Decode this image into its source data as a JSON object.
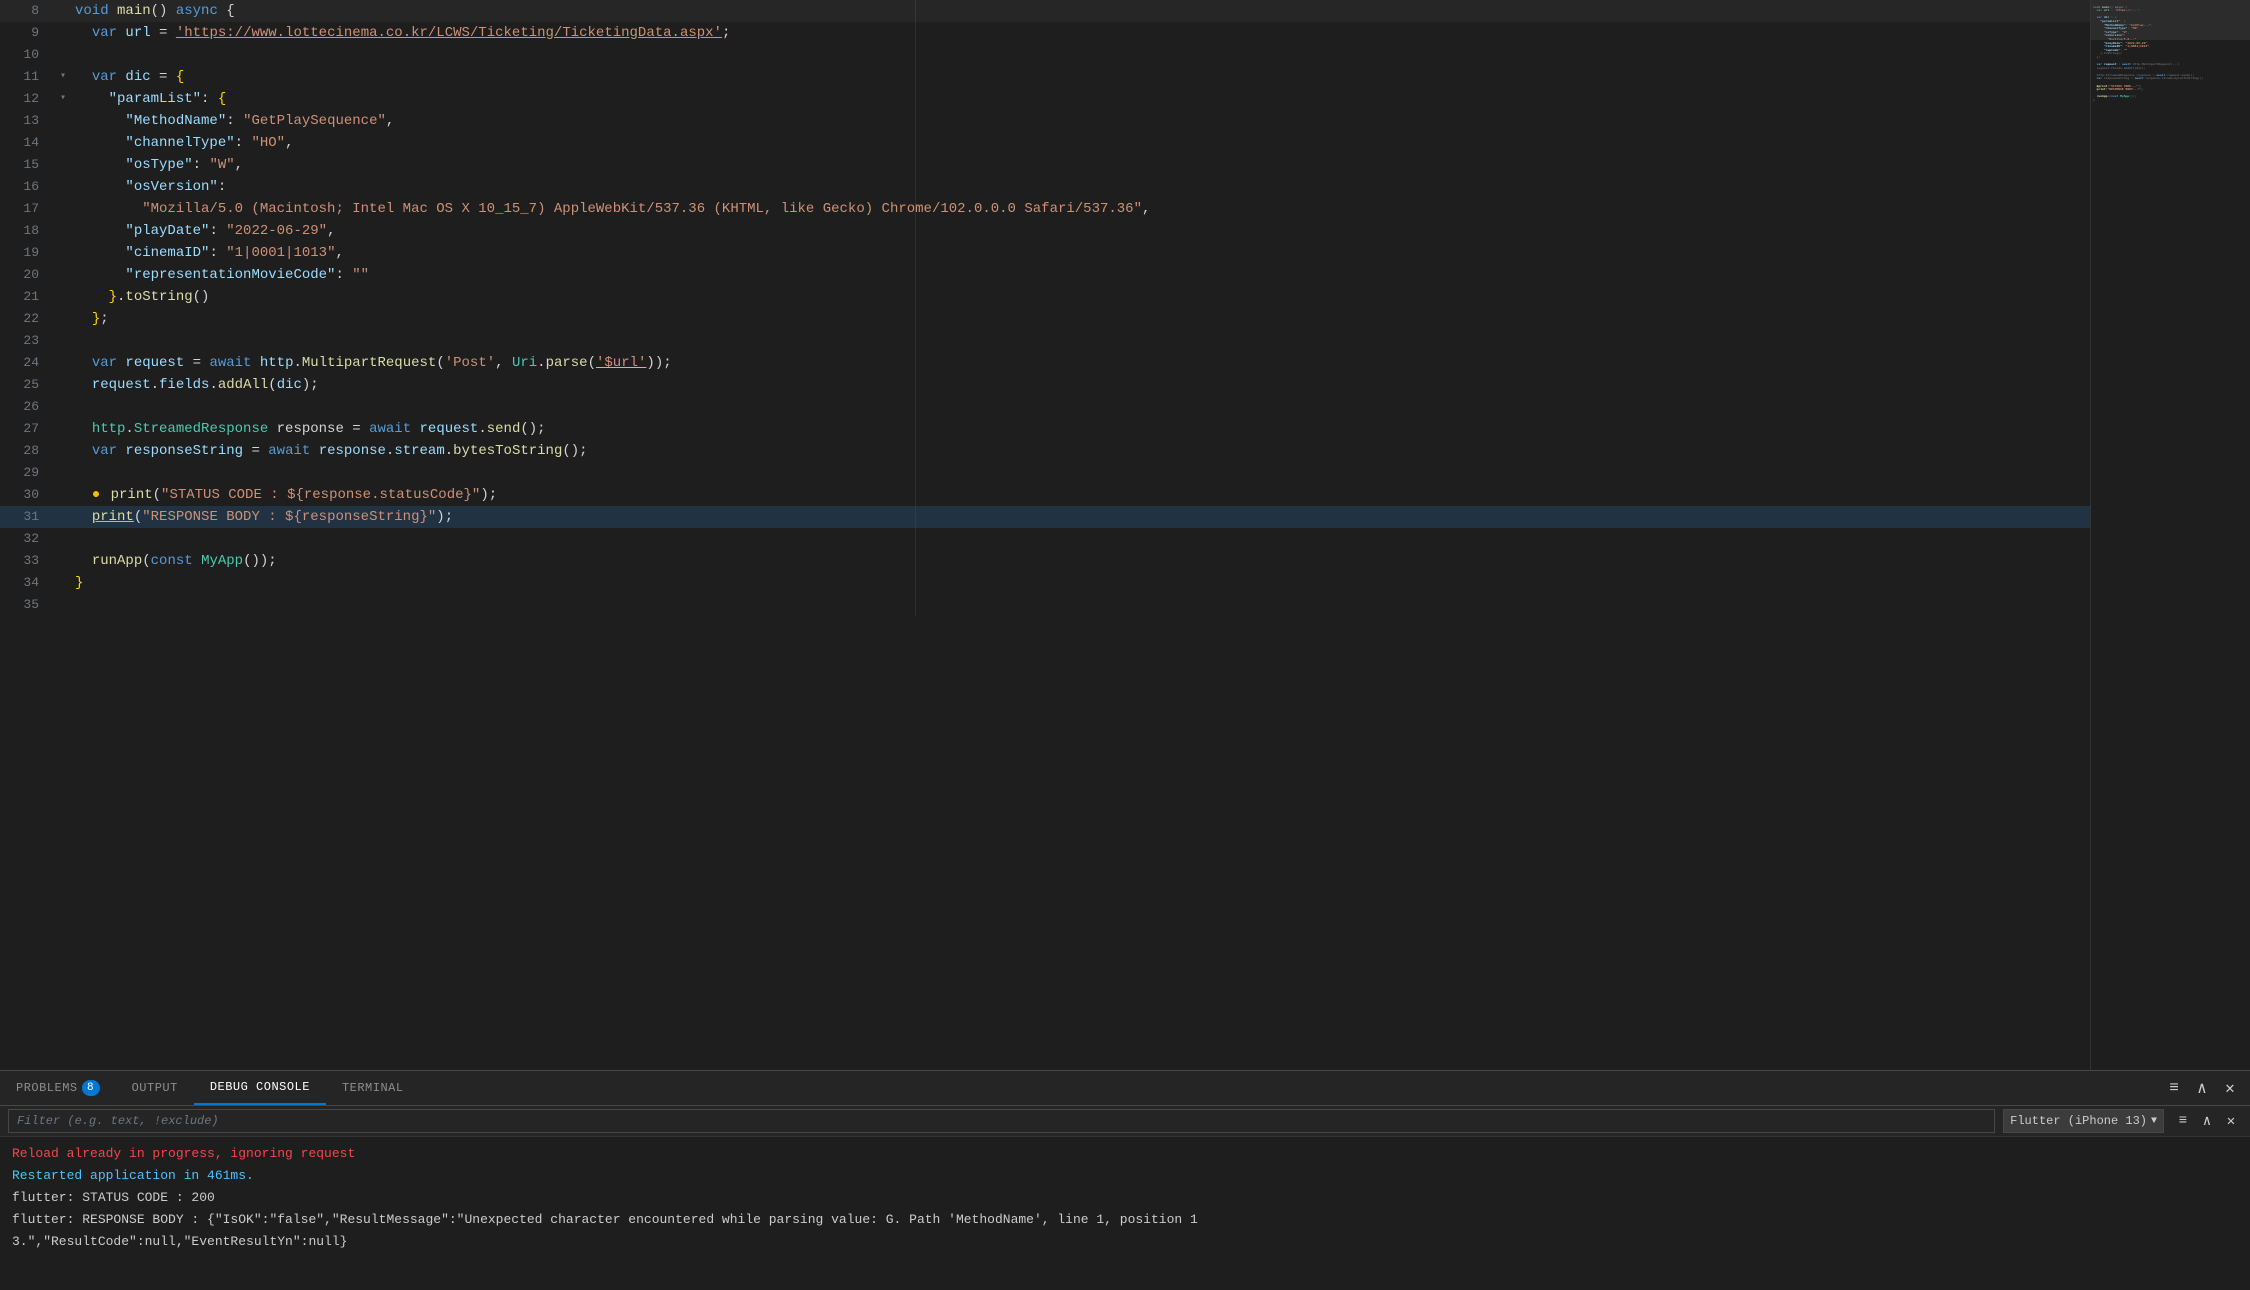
{
  "editor": {
    "lines": [
      {
        "num": 8,
        "hasFold": false,
        "indent": 0,
        "tokens": [
          {
            "t": "kw",
            "v": "void "
          },
          {
            "t": "fn",
            "v": "main"
          },
          {
            "t": "punct",
            "v": "() "
          },
          {
            "t": "kw",
            "v": "async "
          },
          {
            "t": "punct",
            "v": "{"
          }
        ]
      },
      {
        "num": 9,
        "hasFold": false,
        "indent": 1,
        "tokens": [
          {
            "t": "kw",
            "v": "var "
          },
          {
            "t": "prop",
            "v": "url"
          },
          {
            "t": "op",
            "v": " = "
          },
          {
            "t": "str-url",
            "v": "'https://www.lottecinema.co.kr/LCWS/Ticketing/TicketingData.aspx'"
          },
          {
            "t": "punct",
            "v": ";"
          }
        ]
      },
      {
        "num": 10,
        "hasFold": false,
        "indent": 0,
        "tokens": []
      },
      {
        "num": 11,
        "hasFold": true,
        "foldOpen": true,
        "indent": 1,
        "tokens": [
          {
            "t": "kw",
            "v": "var "
          },
          {
            "t": "prop",
            "v": "dic"
          },
          {
            "t": "op",
            "v": " = "
          },
          {
            "t": "bracket",
            "v": "{"
          }
        ]
      },
      {
        "num": 12,
        "hasFold": true,
        "foldOpen": true,
        "indent": 2,
        "tokens": [
          {
            "t": "key",
            "v": "\"paramList\""
          },
          {
            "t": "punct",
            "v": ": "
          },
          {
            "t": "bracket",
            "v": "{"
          }
        ]
      },
      {
        "num": 13,
        "hasFold": false,
        "indent": 3,
        "tokens": [
          {
            "t": "key",
            "v": "\"MethodName\""
          },
          {
            "t": "punct",
            "v": ": "
          },
          {
            "t": "val-str",
            "v": "\"GetPlaySequence\""
          },
          {
            "t": "punct",
            "v": ","
          }
        ]
      },
      {
        "num": 14,
        "hasFold": false,
        "indent": 3,
        "tokens": [
          {
            "t": "key",
            "v": "\"channelType\""
          },
          {
            "t": "punct",
            "v": ": "
          },
          {
            "t": "val-str",
            "v": "\"HO\""
          },
          {
            "t": "punct",
            "v": ","
          }
        ]
      },
      {
        "num": 15,
        "hasFold": false,
        "indent": 3,
        "tokens": [
          {
            "t": "key",
            "v": "\"osType\""
          },
          {
            "t": "punct",
            "v": ": "
          },
          {
            "t": "val-str",
            "v": "\"W\""
          },
          {
            "t": "punct",
            "v": ","
          }
        ]
      },
      {
        "num": 16,
        "hasFold": false,
        "indent": 3,
        "tokens": [
          {
            "t": "key",
            "v": "\"osVersion\""
          },
          {
            "t": "punct",
            "v": ":"
          }
        ]
      },
      {
        "num": 17,
        "hasFold": false,
        "indent": 4,
        "tokens": [
          {
            "t": "val-str",
            "v": "\"Mozilla/5.0 (Macintosh; Intel Mac OS X 10_15_7) AppleWebKit/537.36 (KHTML, like Gecko) Chrome/102.0.0.0 Safari/537.36\""
          },
          {
            "t": "punct",
            "v": ","
          }
        ]
      },
      {
        "num": 18,
        "hasFold": false,
        "indent": 3,
        "tokens": [
          {
            "t": "key",
            "v": "\"playDate\""
          },
          {
            "t": "punct",
            "v": ": "
          },
          {
            "t": "val-str",
            "v": "\"2022-06-29\""
          },
          {
            "t": "punct",
            "v": ","
          }
        ]
      },
      {
        "num": 19,
        "hasFold": false,
        "indent": 3,
        "tokens": [
          {
            "t": "key",
            "v": "\"cinemaID\""
          },
          {
            "t": "punct",
            "v": ": "
          },
          {
            "t": "val-str",
            "v": "\"1|0001|1013\""
          },
          {
            "t": "punct",
            "v": ","
          }
        ]
      },
      {
        "num": 20,
        "hasFold": false,
        "indent": 3,
        "tokens": [
          {
            "t": "key",
            "v": "\"representationMovieCode\""
          },
          {
            "t": "punct",
            "v": ": "
          },
          {
            "t": "val-str",
            "v": "\"\""
          }
        ]
      },
      {
        "num": 21,
        "hasFold": false,
        "indent": 2,
        "tokens": [
          {
            "t": "bracket",
            "v": "}"
          },
          {
            "t": "method",
            "v": ".toString"
          },
          {
            "t": "punct",
            "v": "()"
          }
        ]
      },
      {
        "num": 22,
        "hasFold": false,
        "indent": 1,
        "tokens": [
          {
            "t": "bracket",
            "v": "}"
          },
          {
            "t": "punct",
            "v": ";"
          }
        ]
      },
      {
        "num": 23,
        "hasFold": false,
        "indent": 0,
        "tokens": []
      },
      {
        "num": 24,
        "hasFold": false,
        "indent": 1,
        "tokens": [
          {
            "t": "kw",
            "v": "var "
          },
          {
            "t": "prop",
            "v": "request"
          },
          {
            "t": "op",
            "v": " = "
          },
          {
            "t": "kw",
            "v": "await "
          },
          {
            "t": "prop",
            "v": "http"
          },
          {
            "t": "punct",
            "v": "."
          },
          {
            "t": "fn",
            "v": "MultipartRequest"
          },
          {
            "t": "punct",
            "v": "("
          },
          {
            "t": "str",
            "v": "'Post'"
          },
          {
            "t": "punct",
            "v": ", "
          },
          {
            "t": "type",
            "v": "Uri"
          },
          {
            "t": "punct",
            "v": "."
          },
          {
            "t": "fn",
            "v": "parse"
          },
          {
            "t": "punct",
            "v": "("
          },
          {
            "t": "str underline-yellow",
            "v": "'$url'"
          },
          {
            "t": "punct",
            "v": "));"
          }
        ]
      },
      {
        "num": 25,
        "hasFold": false,
        "indent": 1,
        "tokens": [
          {
            "t": "prop",
            "v": "request"
          },
          {
            "t": "punct",
            "v": "."
          },
          {
            "t": "prop",
            "v": "fields"
          },
          {
            "t": "punct",
            "v": "."
          },
          {
            "t": "fn",
            "v": "addAll"
          },
          {
            "t": "punct",
            "v": "("
          },
          {
            "t": "prop",
            "v": "dic"
          },
          {
            "t": "punct",
            "v": ");"
          }
        ]
      },
      {
        "num": 26,
        "hasFold": false,
        "indent": 0,
        "tokens": []
      },
      {
        "num": 27,
        "hasFold": false,
        "indent": 1,
        "tokens": [
          {
            "t": "type",
            "v": "http"
          },
          {
            "t": "punct",
            "v": "."
          },
          {
            "t": "type",
            "v": "StreamedResponse"
          },
          {
            "t": "op",
            "v": " response"
          },
          {
            "t": "op",
            "v": " = "
          },
          {
            "t": "kw",
            "v": "await "
          },
          {
            "t": "prop",
            "v": "request"
          },
          {
            "t": "punct",
            "v": "."
          },
          {
            "t": "fn",
            "v": "send"
          },
          {
            "t": "punct",
            "v": "();"
          }
        ]
      },
      {
        "num": 28,
        "hasFold": false,
        "indent": 1,
        "tokens": [
          {
            "t": "kw",
            "v": "var "
          },
          {
            "t": "prop",
            "v": "responseString"
          },
          {
            "t": "op",
            "v": " = "
          },
          {
            "t": "kw",
            "v": "await "
          },
          {
            "t": "prop",
            "v": "response"
          },
          {
            "t": "punct",
            "v": "."
          },
          {
            "t": "prop",
            "v": "stream"
          },
          {
            "t": "punct",
            "v": "."
          },
          {
            "t": "fn",
            "v": "bytesToString"
          },
          {
            "t": "punct",
            "v": "();"
          }
        ]
      },
      {
        "num": 29,
        "hasFold": false,
        "indent": 0,
        "tokens": []
      },
      {
        "num": 30,
        "hasFold": false,
        "indent": 1,
        "isDebugLine": true,
        "tokens": [
          {
            "t": "fn",
            "v": "print"
          },
          {
            "t": "punct",
            "v": "("
          },
          {
            "t": "str",
            "v": "\"STATUS CODE : ${response.statusCode}\""
          },
          {
            "t": "punct",
            "v": ");"
          }
        ]
      },
      {
        "num": 31,
        "hasFold": false,
        "indent": 1,
        "isSelected": true,
        "tokens": [
          {
            "t": "fn underline-yellow",
            "v": "print"
          },
          {
            "t": "punct",
            "v": "("
          },
          {
            "t": "str",
            "v": "\"RESPONSE BODY : ${responseString}\""
          },
          {
            "t": "punct",
            "v": ");"
          }
        ]
      },
      {
        "num": 32,
        "hasFold": false,
        "indent": 0,
        "tokens": []
      },
      {
        "num": 33,
        "hasFold": false,
        "indent": 1,
        "tokens": [
          {
            "t": "fn",
            "v": "runApp"
          },
          {
            "t": "punct",
            "v": "("
          },
          {
            "t": "kw",
            "v": "const "
          },
          {
            "t": "type",
            "v": "MyApp"
          },
          {
            "t": "punct",
            "v": "());"
          }
        ]
      },
      {
        "num": 34,
        "hasFold": false,
        "indent": 0,
        "tokens": [
          {
            "t": "bracket",
            "v": "}"
          }
        ]
      },
      {
        "num": 35,
        "hasFold": false,
        "indent": 0,
        "tokens": []
      }
    ]
  },
  "bottom_panel": {
    "tabs": [
      {
        "id": "problems",
        "label": "PROBLEMS",
        "badge": "8",
        "active": false
      },
      {
        "id": "output",
        "label": "OUTPUT",
        "badge": null,
        "active": false
      },
      {
        "id": "debug",
        "label": "DEBUG CONSOLE",
        "badge": null,
        "active": true
      },
      {
        "id": "terminal",
        "label": "TERMINAL",
        "badge": null,
        "active": false
      }
    ],
    "filter_placeholder": "Filter (e.g. text, !exclude)",
    "dropdown_label": "Flutter (iPhone 13)",
    "console_lines": [
      {
        "cls": "red",
        "text": "Reload already in progress, ignoring request"
      },
      {
        "cls": "cyan",
        "text": "Restarted application in 461ms."
      },
      {
        "cls": "white",
        "text": "flutter: STATUS CODE : 200"
      },
      {
        "cls": "white",
        "text": "flutter: RESPONSE BODY : {\"IsOK\":\"false\",\"ResultMessage\":\"Unexpected character encountered while parsing value: G. Path 'MethodName', line 1, position 1"
      },
      {
        "cls": "white",
        "text": "3.\",\"ResultCode\":null,\"EventResultYn\":null}"
      }
    ]
  }
}
